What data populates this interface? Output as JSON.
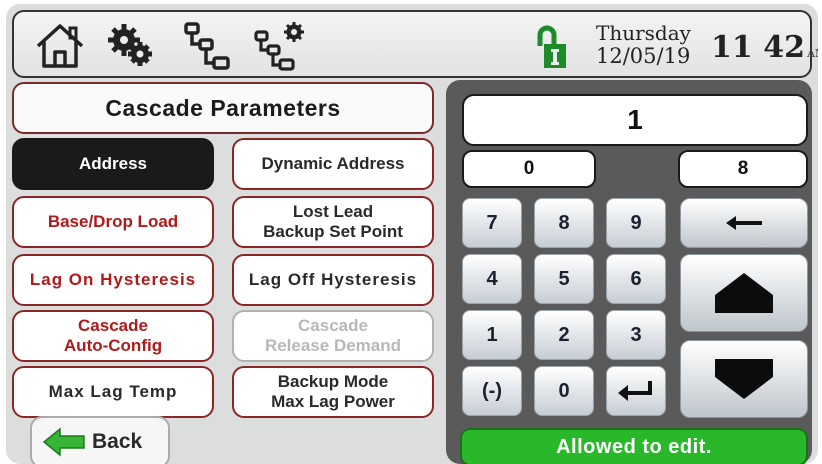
{
  "topbar": {
    "icons": [
      "home-icon",
      "settings-gears-icon",
      "network-icon",
      "network-settings-icon",
      "lock-icon"
    ],
    "day": "Thursday",
    "date": "12/05/19",
    "time": "11 42",
    "ampm": "AM"
  },
  "panel": {
    "title": "Cascade Parameters",
    "buttons": [
      {
        "label": "Address"
      },
      {
        "label": "Dynamic Address"
      },
      {
        "label": "Base/Drop Load"
      },
      {
        "label": "Lost Lead\nBackup Set Point"
      },
      {
        "label": "Lag On Hysteresis"
      },
      {
        "label": "Lag Off Hysteresis"
      },
      {
        "label": "Cascade\nAuto-Config"
      },
      {
        "label": "Cascade\nRelease Demand"
      },
      {
        "label": "Max Lag Temp"
      },
      {
        "label": "Backup Mode\nMax Lag Power"
      }
    ],
    "back_label": "Back"
  },
  "keypad": {
    "value": "1",
    "min": "0",
    "max": "8",
    "keys": [
      "7",
      "8",
      "9",
      "4",
      "5",
      "6",
      "1",
      "2",
      "3",
      "(-)",
      "0"
    ],
    "status": "Allowed to edit.",
    "colors": {
      "status": "#29b829",
      "active": "#1a1a1a",
      "accent": "#b01a1a"
    }
  }
}
